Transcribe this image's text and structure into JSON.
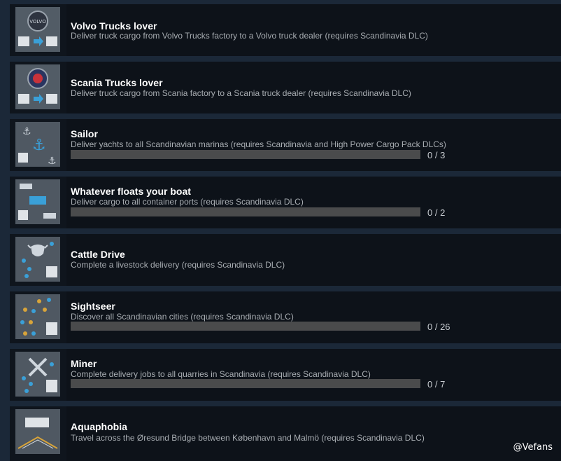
{
  "achievements": [
    {
      "title": "Volvo Trucks lover",
      "description": "Deliver truck cargo from Volvo Trucks factory to a Volvo truck dealer (requires Scandinavia DLC)",
      "icon": "volvo-truck-icon"
    },
    {
      "title": "Scania Trucks lover",
      "description": "Deliver truck cargo from Scania factory to a Scania truck dealer (requires Scandinavia DLC)",
      "icon": "scania-truck-icon"
    },
    {
      "title": "Sailor",
      "description": "Deliver yachts to all Scandinavian marinas (requires Scandinavia and High Power Cargo Pack DLCs)",
      "icon": "anchor-icon",
      "progress": {
        "text": "0 / 3",
        "value": 0,
        "max": 3
      }
    },
    {
      "title": "Whatever floats your boat",
      "description": "Deliver cargo to all container ports (requires Scandinavia DLC)",
      "icon": "container-icon",
      "progress": {
        "text": "0 / 2",
        "value": 0,
        "max": 2
      }
    },
    {
      "title": "Cattle Drive",
      "description": "Complete a livestock delivery (requires Scandinavia DLC)",
      "icon": "cattle-icon"
    },
    {
      "title": "Sightseer",
      "description": "Discover all Scandinavian cities (requires Scandinavia DLC)",
      "icon": "city-map-icon",
      "progress": {
        "text": "0 / 26",
        "value": 0,
        "max": 26
      }
    },
    {
      "title": "Miner",
      "description": "Complete delivery jobs to all quarries in Scandinavia (requires Scandinavia DLC)",
      "icon": "pickaxe-icon",
      "progress": {
        "text": "0 / 7",
        "value": 0,
        "max": 7
      }
    },
    {
      "title": "Aquaphobia",
      "description": "Travel across the Øresund Bridge between København and Malmö (requires Scandinavia DLC)",
      "icon": "bridge-icon"
    }
  ],
  "watermark": "@Vefans",
  "colors": {
    "background": "#1b2838",
    "row": "#0d1219",
    "title": "#ffffff",
    "description": "#a8adb2",
    "bar": "#4a4b4c"
  }
}
